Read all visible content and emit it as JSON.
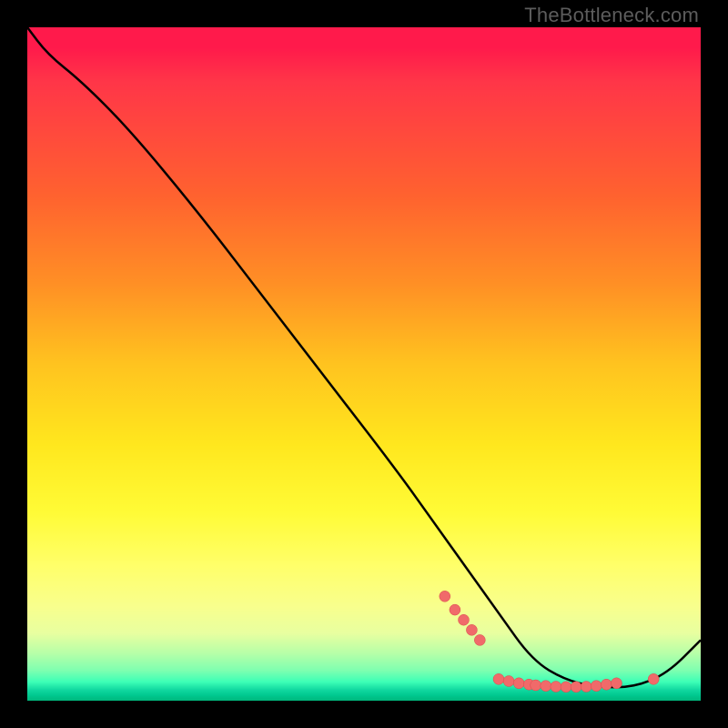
{
  "watermark": "TheBottleneck.com",
  "colors": {
    "curve": "#000000",
    "dot_fill": "#f06a6a",
    "dot_stroke": "#d94a4a"
  },
  "chart_data": {
    "type": "line",
    "title": "",
    "xlabel": "",
    "ylabel": "",
    "xlim": [
      0,
      100
    ],
    "ylim": [
      0,
      100
    ],
    "grid": false,
    "legend": false,
    "series": [
      {
        "name": "curve",
        "x": [
          0,
          3,
          8,
          15,
          25,
          35,
          45,
          55,
          60,
          65,
          70,
          75,
          80,
          85,
          90,
          95,
          100
        ],
        "y": [
          100,
          96,
          92,
          85,
          73,
          60,
          47,
          34,
          27,
          20,
          13,
          6,
          3,
          2,
          2,
          4,
          9
        ]
      }
    ],
    "dots": {
      "left_cluster_x": [
        62,
        63.5,
        64.8,
        66,
        67.2
      ],
      "left_cluster_y": [
        15.5,
        13.5,
        12,
        10.5,
        9
      ],
      "bottom_cluster_x": [
        70,
        71.5,
        73,
        74.5,
        75.5,
        77,
        78.5,
        80,
        81.5,
        83,
        84.5,
        86,
        87.5
      ],
      "bottom_cluster_y": [
        3.2,
        2.9,
        2.6,
        2.4,
        2.3,
        2.2,
        2.1,
        2.05,
        2.05,
        2.1,
        2.2,
        2.4,
        2.6
      ],
      "right_dot": {
        "x": 93,
        "y": 3.2
      }
    }
  }
}
